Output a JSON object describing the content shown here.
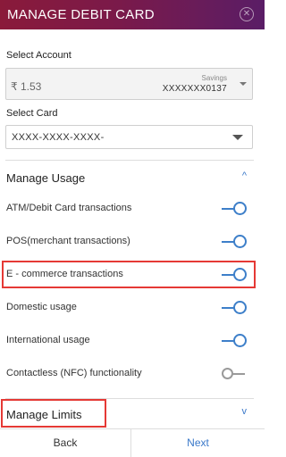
{
  "header": {
    "title": "MANAGE DEBIT CARD",
    "close_icon": "close-circle-icon"
  },
  "account": {
    "label": "Select Account",
    "balance": "₹ 1.53",
    "type": "Savings",
    "number": "XXXXXXX0137"
  },
  "card": {
    "label": "Select Card",
    "value": "XXXX-XXXX-XXXX-"
  },
  "manage_usage": {
    "title": "Manage Usage",
    "expanded": true,
    "items": [
      {
        "label": "ATM/Debit Card transactions",
        "enabled": true
      },
      {
        "label": "POS(merchant transactions)",
        "enabled": true
      },
      {
        "label": "E - commerce transactions",
        "enabled": true
      },
      {
        "label": "Domestic usage",
        "enabled": true
      },
      {
        "label": "International usage",
        "enabled": true
      },
      {
        "label": "Contactless (NFC) functionality",
        "enabled": false
      }
    ]
  },
  "manage_limits": {
    "title": "Manage Limits",
    "expanded": false
  },
  "footer": {
    "back_label": "Back",
    "next_label": "Next"
  },
  "colors": {
    "accent": "#3a78c9",
    "header_start": "#8a1a3a",
    "header_end": "#5a1d66",
    "highlight": "#e53935"
  }
}
